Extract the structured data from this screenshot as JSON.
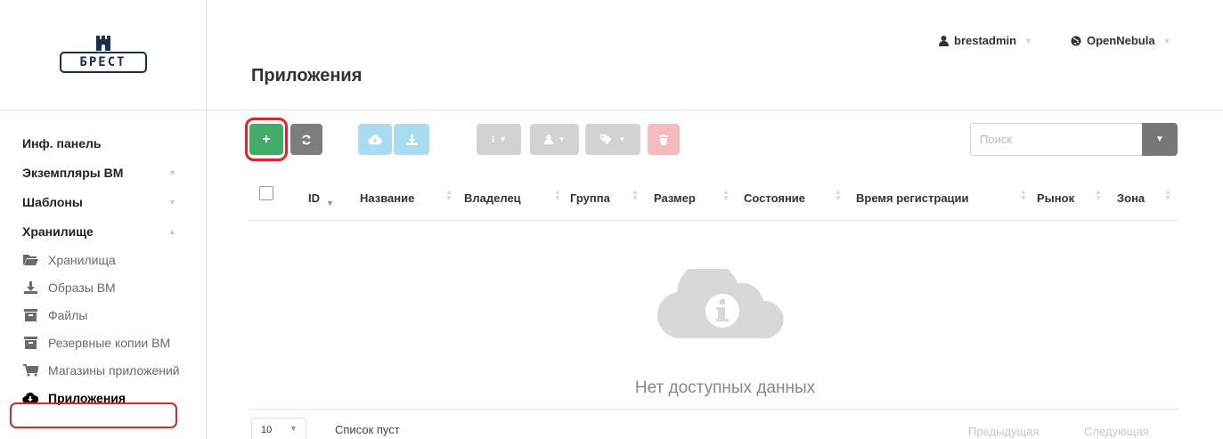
{
  "brand": {
    "name": "БРЕСТ"
  },
  "header": {
    "title": "Приложения",
    "user": "brestadmin",
    "zone": "OpenNebula"
  },
  "sidebar": {
    "items": [
      {
        "label": "Инф. панель"
      },
      {
        "label": "Экземпляры ВМ"
      },
      {
        "label": "Шаблоны"
      },
      {
        "label": "Хранилище"
      }
    ],
    "storage_items": [
      {
        "label": "Хранилища",
        "icon": "folder-open-icon"
      },
      {
        "label": "Образы ВМ",
        "icon": "download-icon"
      },
      {
        "label": "Файлы",
        "icon": "archive-icon"
      },
      {
        "label": "Резервные копии ВМ",
        "icon": "archive-icon"
      },
      {
        "label": "Магазины приложений",
        "icon": "cart-icon"
      },
      {
        "label": "Приложения",
        "icon": "cloud-download-icon",
        "active": true
      }
    ]
  },
  "toolbar": {
    "create_icon": "+",
    "refresh_icon": "refresh-icon",
    "search_placeholder": "Поиск"
  },
  "table": {
    "columns": [
      {
        "label": "ID"
      },
      {
        "label": "Название"
      },
      {
        "label": "Владелец"
      },
      {
        "label": "Группа"
      },
      {
        "label": "Размер"
      },
      {
        "label": "Состояние"
      },
      {
        "label": "Время регистрации"
      },
      {
        "label": "Рынок"
      },
      {
        "label": "Зона"
      }
    ],
    "empty_message": "Нет доступных данных",
    "page_length": "10",
    "info": "Список пуст",
    "prev": "Предыдущая",
    "next": "Следующая"
  },
  "colors": {
    "accent_green": "#43ac6a",
    "highlight_red": "#e2232a",
    "sort_active": "#5b9bd5"
  }
}
